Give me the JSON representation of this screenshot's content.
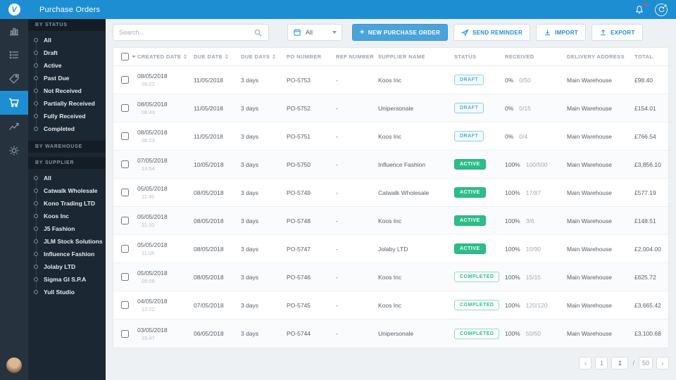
{
  "colors": {
    "accent": "#1e8ed3",
    "green": "#2cbd88",
    "draft_blue": "#54abdf",
    "sidebar_dark": "#1b2733",
    "alert_red": "#e74c3c"
  },
  "topbar": {
    "title": "Purchase Orders",
    "logo_letter": "V",
    "icons": [
      "bell-icon",
      "refresh-icon"
    ]
  },
  "rail": {
    "items": [
      {
        "name": "analytics",
        "active": false
      },
      {
        "name": "orders-list",
        "active": false
      },
      {
        "name": "products-tag",
        "active": false
      },
      {
        "name": "purchase-orders-cart",
        "active": true
      },
      {
        "name": "reports-trend",
        "active": false
      },
      {
        "name": "settings-gear",
        "active": false
      }
    ]
  },
  "filters": {
    "by_status": {
      "label": "BY STATUS",
      "items": [
        "All",
        "Draft",
        "Active",
        "Past Due",
        "Not Received",
        "Partially Received",
        "Fully Received",
        "Completed"
      ]
    },
    "by_warehouse": {
      "label": "BY WAREHOUSE"
    },
    "by_supplier": {
      "label": "BY SUPPLIER",
      "items": [
        "All",
        "Catwalk Wholesale",
        "Kono Trading LTD",
        "Koos Inc",
        "J5 Fashion",
        "JLM Stock Solutions",
        "Influence Fashion",
        "Jolaby LTD",
        "Sigma GI S.P.A",
        "Yull Studio"
      ]
    }
  },
  "toolbar": {
    "search_placeholder": "Search...",
    "date_filter_value": "All",
    "new_button_icon": "+",
    "new_button": "NEW PURCHASE ORDER",
    "send_reminder_button": "SEND REMINDER",
    "import_button": "IMPORT",
    "export_button": "EXPORT"
  },
  "table": {
    "columns": [
      {
        "label": "CREATED DATE",
        "sortable": true
      },
      {
        "label": "DUE DATE",
        "sortable": true
      },
      {
        "label": "DUE DAYS",
        "sortable": true
      },
      {
        "label": "PO NUMBER",
        "sortable": false
      },
      {
        "label": "REF NUMBER",
        "sortable": false
      },
      {
        "label": "SUPPLIER NAME",
        "sortable": false
      },
      {
        "label": "STATUS",
        "sortable": false
      },
      {
        "label": "RECEIVED",
        "sortable": false
      },
      {
        "label": "DELIVERY ADDRESS",
        "sortable": false
      },
      {
        "label": "TOTAL",
        "sortable": false
      }
    ],
    "rows": [
      {
        "created_date": "08/05/2018",
        "created_time": "09:22",
        "due_date": "11/05/2018",
        "due_days": "3 days",
        "po_number": "PO-5753",
        "ref_number": "-",
        "supplier": "Koos Inc",
        "status": "DRAFT",
        "received_pct": "0%",
        "received_qty": "0/50",
        "address": "Main Warehouse",
        "total": "£98.40"
      },
      {
        "created_date": "08/05/2018",
        "created_time": "08:43",
        "due_date": "11/05/2018",
        "due_days": "3 days",
        "po_number": "PO-5752",
        "ref_number": "-",
        "supplier": "Unipersonale",
        "status": "DRAFT",
        "received_pct": "0%",
        "received_qty": "0/15",
        "address": "Main Warehouse",
        "total": "£154.01"
      },
      {
        "created_date": "08/05/2018",
        "created_time": "08:23",
        "due_date": "11/05/2018",
        "due_days": "3 days",
        "po_number": "PO-5751",
        "ref_number": "-",
        "supplier": "Koos Inc",
        "status": "DRAFT",
        "received_pct": "0%",
        "received_qty": "0/4",
        "address": "Main Warehouse",
        "total": "£766.54"
      },
      {
        "created_date": "07/05/2018",
        "created_time": "13:54",
        "due_date": "10/05/2018",
        "due_days": "3 days",
        "po_number": "PO-5750",
        "ref_number": "-",
        "supplier": "Influence Fashion",
        "status": "ACTIVE",
        "received_pct": "100%",
        "received_qty": "100/500",
        "address": "Main Warehouse",
        "total": "£3,856.10"
      },
      {
        "created_date": "05/05/2018",
        "created_time": "11:45",
        "due_date": "08/05/2018",
        "due_days": "3 days",
        "po_number": "PO-5749",
        "ref_number": "-",
        "supplier": "Catwalk Wholesale",
        "status": "ACTIVE",
        "received_pct": "100%",
        "received_qty": "17/87",
        "address": "Main Warehouse",
        "total": "£577.19"
      },
      {
        "created_date": "05/05/2018",
        "created_time": "11:10",
        "due_date": "08/05/2018",
        "due_days": "3 days",
        "po_number": "PO-5748",
        "ref_number": "-",
        "supplier": "Koos Inc",
        "status": "ACTIVE",
        "received_pct": "100%",
        "received_qty": "3/6",
        "address": "Main Warehouse",
        "total": "£148.51"
      },
      {
        "created_date": "05/05/2018",
        "created_time": "11:04",
        "due_date": "08/05/2018",
        "due_days": "3 days",
        "po_number": "PO-5747",
        "ref_number": "-",
        "supplier": "Jolaby LTD",
        "status": "ACTIVE",
        "received_pct": "100%",
        "received_qty": "10/90",
        "address": "Main Warehouse",
        "total": "£2,004.00"
      },
      {
        "created_date": "05/05/2018",
        "created_time": "09:56",
        "due_date": "08/05/2018",
        "due_days": "3 days",
        "po_number": "PO-5746",
        "ref_number": "-",
        "supplier": "Koos Inc",
        "status": "COMPLETED",
        "received_pct": "100%",
        "received_qty": "15/15",
        "address": "Main Warehouse",
        "total": "£625.72"
      },
      {
        "created_date": "04/05/2018",
        "created_time": "12:22",
        "due_date": "07/05/2018",
        "due_days": "3 days",
        "po_number": "PO-5745",
        "ref_number": "-",
        "supplier": "Koos Inc",
        "status": "COMPLETED",
        "received_pct": "100%",
        "received_qty": "120/120",
        "address": "Main Warehouse",
        "total": "£3,665.42"
      },
      {
        "created_date": "03/05/2018",
        "created_time": "15:47",
        "due_date": "06/05/2018",
        "due_days": "3 days",
        "po_number": "PO-5744",
        "ref_number": "-",
        "supplier": "Unipersonale",
        "status": "COMPLETED",
        "received_pct": "100%",
        "received_qty": "50/50",
        "address": "Main Warehouse",
        "total": "£3,100.68"
      }
    ]
  },
  "pagination": {
    "prev": "‹",
    "first": "1",
    "current": "1",
    "separator": "/",
    "total_pages": "50",
    "next": "›"
  }
}
